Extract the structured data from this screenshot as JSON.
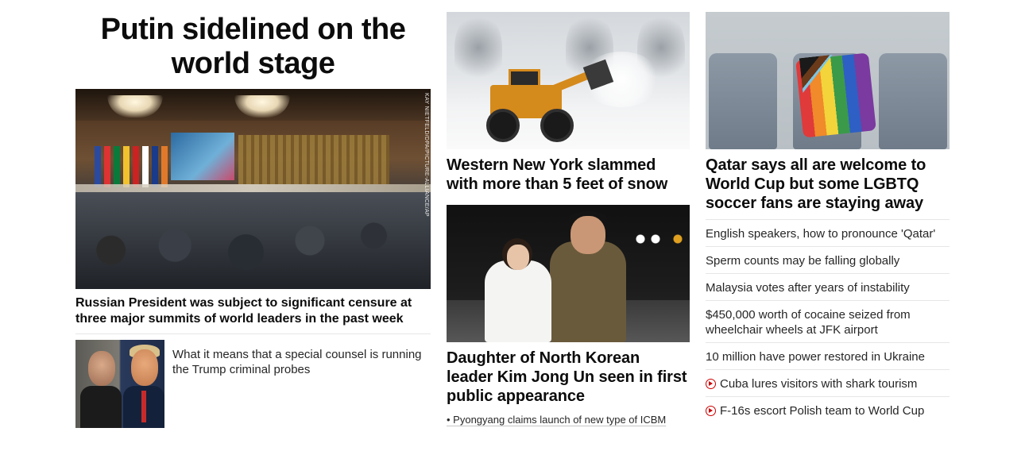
{
  "lead": {
    "headline": "Putin sidelined on the world stage",
    "photo_credit": "KAY NIETFELD/DPA/PICTURE-ALLIANCE/AP",
    "caption": "Russian President was subject to significant censure at three major summits of world leaders in the past week",
    "sub_story": "What it means that a special counsel is running the Trump criminal probes"
  },
  "middle": {
    "story1": {
      "title": "Western New York slammed with more than 5 feet of snow"
    },
    "story2": {
      "title": "Daughter of North Korean leader Kim Jong Un seen in first public appearance",
      "related": "• Pyongyang claims launch of new type of ICBM"
    }
  },
  "right": {
    "feature": {
      "title": "Qatar says all are welcome to World Cup but some LGBTQ soccer fans are staying away"
    },
    "list": [
      {
        "text": "English speakers, how to pronounce 'Qatar'",
        "video": false
      },
      {
        "text": "Sperm counts may be falling globally",
        "video": false
      },
      {
        "text": "Malaysia votes after years of instability",
        "video": false
      },
      {
        "text": "$450,000 worth of cocaine seized from wheelchair wheels at JFK airport",
        "video": false
      },
      {
        "text": "10 million have power restored in Ukraine",
        "video": false
      },
      {
        "text": "Cuba lures visitors with shark tourism",
        "video": true
      },
      {
        "text": "F-16s escort Polish team to World Cup",
        "video": true
      }
    ]
  },
  "colors": {
    "video_icon": "#cc0000",
    "divider": "#e6e6e6",
    "text": "#0c0c0c"
  }
}
